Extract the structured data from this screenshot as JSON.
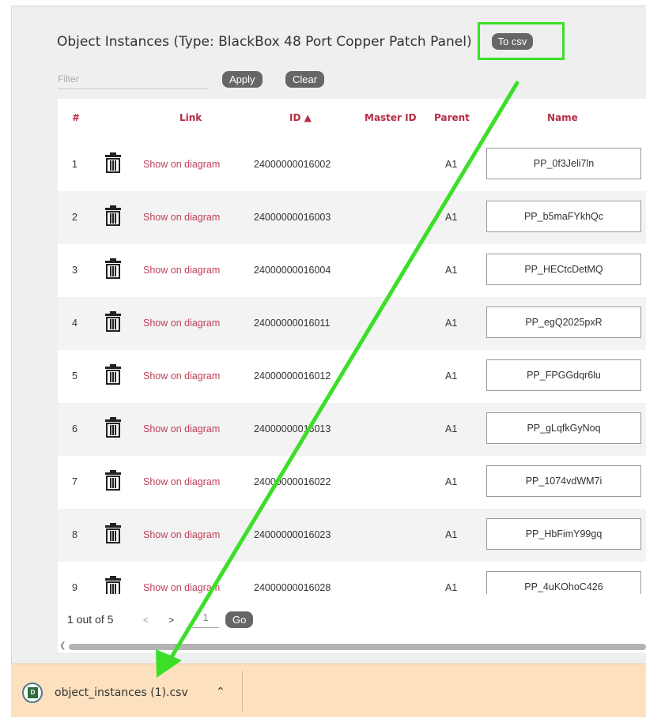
{
  "panel": {
    "title": "Object Instances (Type: BlackBox 48 Port Copper Patch Panel)",
    "to_csv_label": "To csv"
  },
  "filter": {
    "placeholder": "Filter",
    "apply_label": "Apply",
    "clear_label": "Clear"
  },
  "table": {
    "headers": {
      "num": "#",
      "link": "Link",
      "id": "ID ▲",
      "master_id": "Master ID",
      "parent": "Parent",
      "name": "Name"
    },
    "rows": [
      {
        "num": "1",
        "link": "Show on diagram",
        "id": "24000000016002",
        "master_id": "",
        "parent": "A1",
        "name": "PP_0f3Jeli7ln"
      },
      {
        "num": "2",
        "link": "Show on diagram",
        "id": "24000000016003",
        "master_id": "",
        "parent": "A1",
        "name": "PP_b5maFYkhQc"
      },
      {
        "num": "3",
        "link": "Show on diagram",
        "id": "24000000016004",
        "master_id": "",
        "parent": "A1",
        "name": "PP_HECtcDetMQ"
      },
      {
        "num": "4",
        "link": "Show on diagram",
        "id": "24000000016011",
        "master_id": "",
        "parent": "A1",
        "name": "PP_egQ2025pxR"
      },
      {
        "num": "5",
        "link": "Show on diagram",
        "id": "24000000016012",
        "master_id": "",
        "parent": "A1",
        "name": "PP_FPGGdqr6lu"
      },
      {
        "num": "6",
        "link": "Show on diagram",
        "id": "24000000016013",
        "master_id": "",
        "parent": "A1",
        "name": "PP_gLqfkGyNoq"
      },
      {
        "num": "7",
        "link": "Show on diagram",
        "id": "24000000016022",
        "master_id": "",
        "parent": "A1",
        "name": "PP_1074vdWM7i"
      },
      {
        "num": "8",
        "link": "Show on diagram",
        "id": "24000000016023",
        "master_id": "",
        "parent": "A1",
        "name": "PP_HbFimY99gq"
      },
      {
        "num": "9",
        "link": "Show on diagram",
        "id": "24000000016028",
        "master_id": "",
        "parent": "A1",
        "name": "PP_4uKOhoC426"
      }
    ]
  },
  "pagination": {
    "summary": "1 out of 5",
    "prev": "<",
    "next": ">",
    "page_value": "1",
    "go_label": "Go"
  },
  "download_bar": {
    "file_name": "object_instances (1).csv",
    "chevron": "^",
    "icon_letter": "D"
  },
  "colors": {
    "header_text": "#b42d45",
    "link_text": "#c0405a",
    "annotation_green": "#3cdf27",
    "button_bg": "#666666",
    "download_bar_bg": "#fde1bf"
  },
  "icons": {
    "row_action": "trash-icon",
    "download_file": "csv-file-icon",
    "expand": "chevron-up-icon"
  }
}
